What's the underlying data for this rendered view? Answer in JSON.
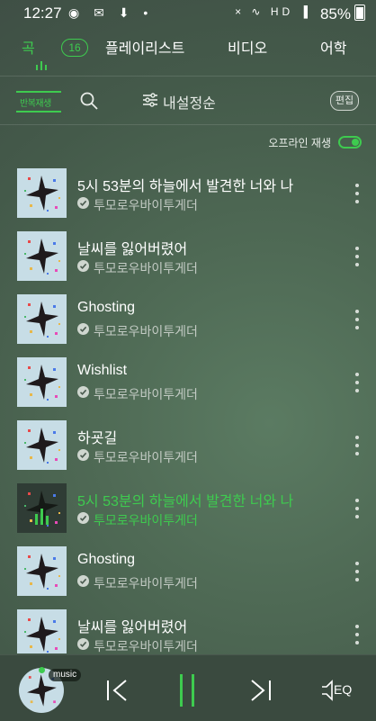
{
  "status_bar": {
    "time": "12:27",
    "left_icons": "◉ ✉ ⬇ •",
    "right_icons": "× ∿ HD ▐",
    "battery": "85%"
  },
  "tabs": {
    "songs": {
      "label": "곡",
      "count": "16"
    },
    "playlists": "플레이리스트",
    "videos": "비디오",
    "language": "어학"
  },
  "toolbar": {
    "repeat_label": "반복재생",
    "sort_label": "내설정순",
    "edit_label": "편집"
  },
  "offline": {
    "label": "오프라인 재생",
    "enabled": true
  },
  "songs": [
    {
      "title": "5시 53분의 하늘에서 발견한 너와 나",
      "artist": "투모로우바이투게더",
      "playing": false
    },
    {
      "title": "날씨를 잃어버렸어",
      "artist": "투모로우바이투게더",
      "playing": false
    },
    {
      "title": "Ghosting",
      "artist": "투모로우바이투게더",
      "playing": false
    },
    {
      "title": "Wishlist",
      "artist": "투모로우바이투게더",
      "playing": false
    },
    {
      "title": "하굣길",
      "artist": "투모로우바이투게더",
      "playing": false
    },
    {
      "title": "5시 53분의 하늘에서 발견한 너와 나",
      "artist": "투모로우바이투게더",
      "playing": true
    },
    {
      "title": "Ghosting",
      "artist": "투모로우바이투게더",
      "playing": false
    },
    {
      "title": "날씨를 잃어버렸어",
      "artist": "투모로우바이투게더",
      "playing": false
    }
  ],
  "player": {
    "badge": "music",
    "eq_label": "EQ",
    "state": "playing"
  },
  "colors": {
    "accent": "#3ecb4f",
    "background": "#4a5a4f",
    "player_bar": "#3a4a3f"
  },
  "icons": {
    "search": "search-icon",
    "sort": "sort-icon",
    "more": "more-vertical-icon",
    "check": "check-circle-icon",
    "prev": "skip-previous-icon",
    "pause": "pause-icon",
    "next": "skip-next-icon",
    "eq": "equalizer-icon"
  }
}
